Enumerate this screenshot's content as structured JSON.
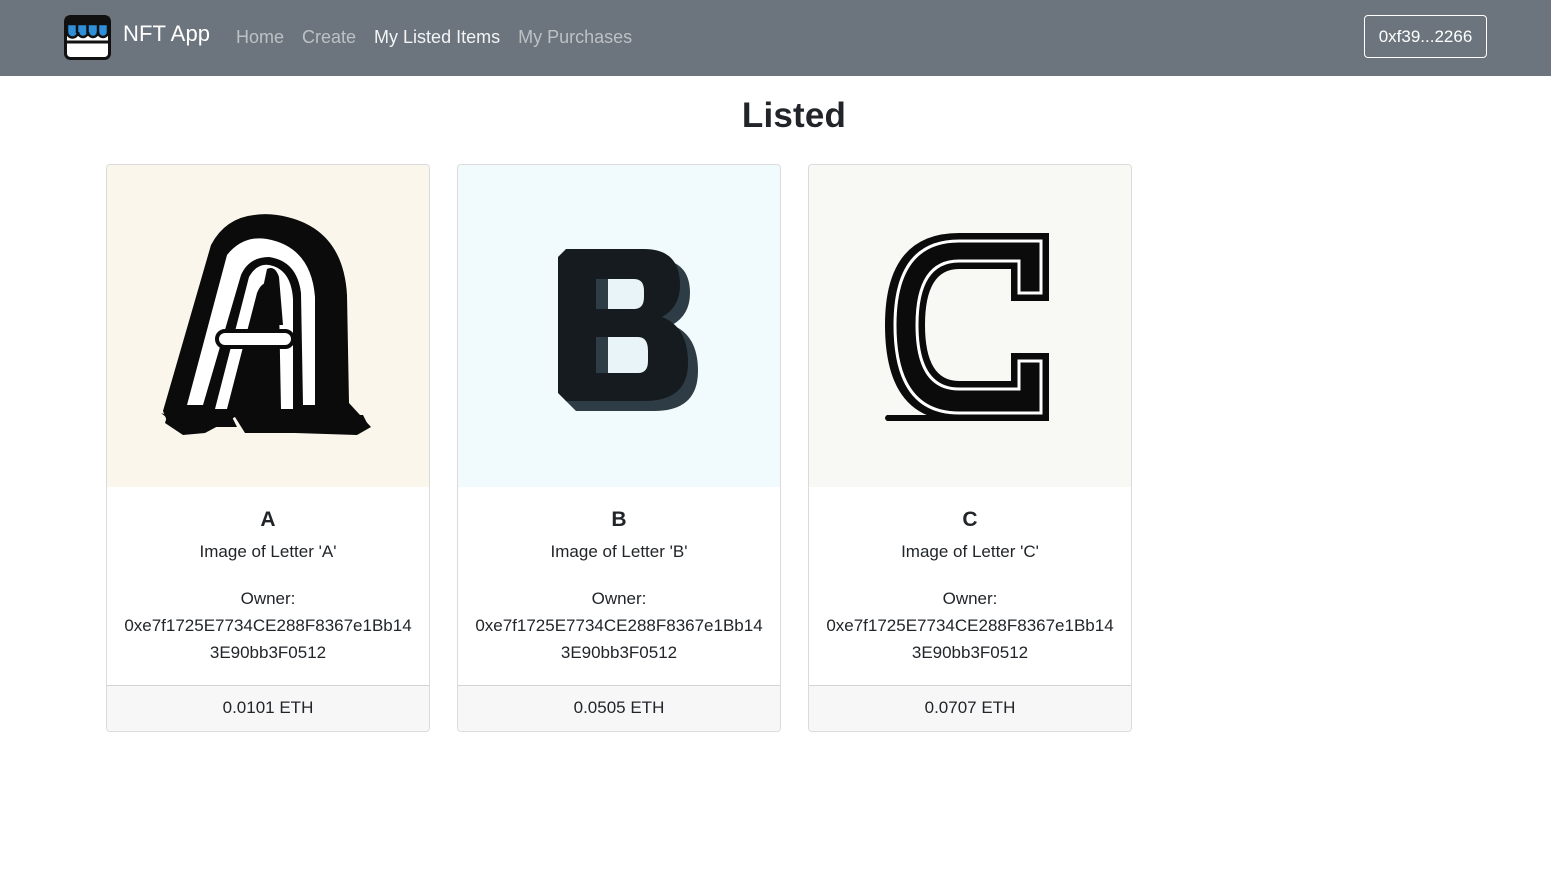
{
  "navbar": {
    "brand": "NFT App",
    "account": "0xf39...2266",
    "links": [
      {
        "label": "Home",
        "active": false
      },
      {
        "label": "Create",
        "active": false
      },
      {
        "label": "My Listed Items",
        "active": true
      },
      {
        "label": "My Purchases",
        "active": false
      }
    ]
  },
  "page": {
    "title": "Listed"
  },
  "items": [
    {
      "name": "A",
      "description": "Image of Letter 'A'",
      "owner_label": "Owner:",
      "owner": "0xe7f1725E7734CE288F8367e1Bb143E90bb3F0512",
      "price": "0.0101 ETH",
      "image_bg": "#faf6ec"
    },
    {
      "name": "B",
      "description": "Image of Letter 'B'",
      "owner_label": "Owner:",
      "owner": "0xe7f1725E7734CE288F8367e1Bb143E90bb3F0512",
      "price": "0.0505 ETH",
      "image_bg": "#f1fafc"
    },
    {
      "name": "C",
      "description": "Image of Letter 'C'",
      "owner_label": "Owner:",
      "owner": "0xe7f1725E7734CE288F8367e1Bb143E90bb3F0512",
      "price": "0.0707 ETH",
      "image_bg": "#f8f8f4"
    }
  ],
  "colors": {
    "navbar_bg": "#6c757d",
    "footer_bg": "#f7f7f7",
    "logo_blue": "#2f8fd8"
  }
}
